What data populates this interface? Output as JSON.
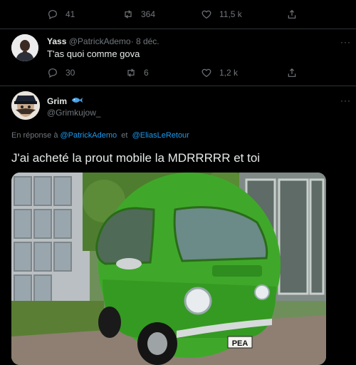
{
  "tweet_top": {
    "replies": "41",
    "retweets": "364",
    "likes": "11,5 k"
  },
  "reply_yass": {
    "name": "Yass",
    "handle": "@PatrickAdemo",
    "separator": "·",
    "date": "8 déc.",
    "text": "T'as quoi comme gova",
    "replies": "30",
    "retweets": "6",
    "likes": "1,2 k"
  },
  "reply_grim": {
    "name": "Grim",
    "handle": "@Grimkujow_",
    "in_reply_prefix": "En réponse à",
    "mention1": "@PatrickAdemo",
    "mention_joiner": "et",
    "mention2": "@EliasLeRetour",
    "text": "J'ai acheté la prout mobile la MDRRRRR et toi",
    "plate": "PEA"
  },
  "icons": {
    "reply": "reply-icon",
    "retweet": "retweet-icon",
    "like": "heart-icon",
    "share": "share-icon",
    "badge": "fish-emoji-icon"
  },
  "colors": {
    "background": "#000000",
    "muted": "#71767b",
    "link": "#1d9bf0",
    "text": "#e7e9ea",
    "car_green": "#3fa82a"
  }
}
